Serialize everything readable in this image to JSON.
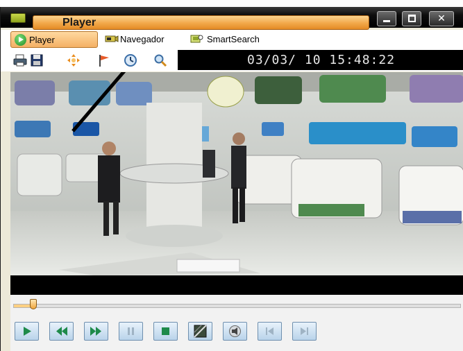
{
  "window": {
    "title": "Player"
  },
  "tabs": [
    {
      "label": "Player"
    },
    {
      "label": "Navegador"
    },
    {
      "label": "SmartSearch"
    }
  ],
  "toolbar": {
    "datetime": "03/03/ 10 15:48:22"
  },
  "playback": {
    "position_fraction": 0.045
  },
  "icons": {
    "toolbar": [
      "print-icon",
      "save-icon",
      "zoom-area-icon",
      "flag-icon",
      "clock-icon",
      "search-icon"
    ],
    "controls": [
      "play-icon",
      "rewind-icon",
      "fast-forward-icon",
      "pause-icon",
      "stop-icon",
      "snapshot-icon",
      "audio-icon",
      "previous-frame-icon",
      "next-frame-icon"
    ]
  },
  "colors": {
    "accent": "#f2a84a",
    "titlebar": "#000000",
    "control_blue": "#b9d3ea"
  }
}
